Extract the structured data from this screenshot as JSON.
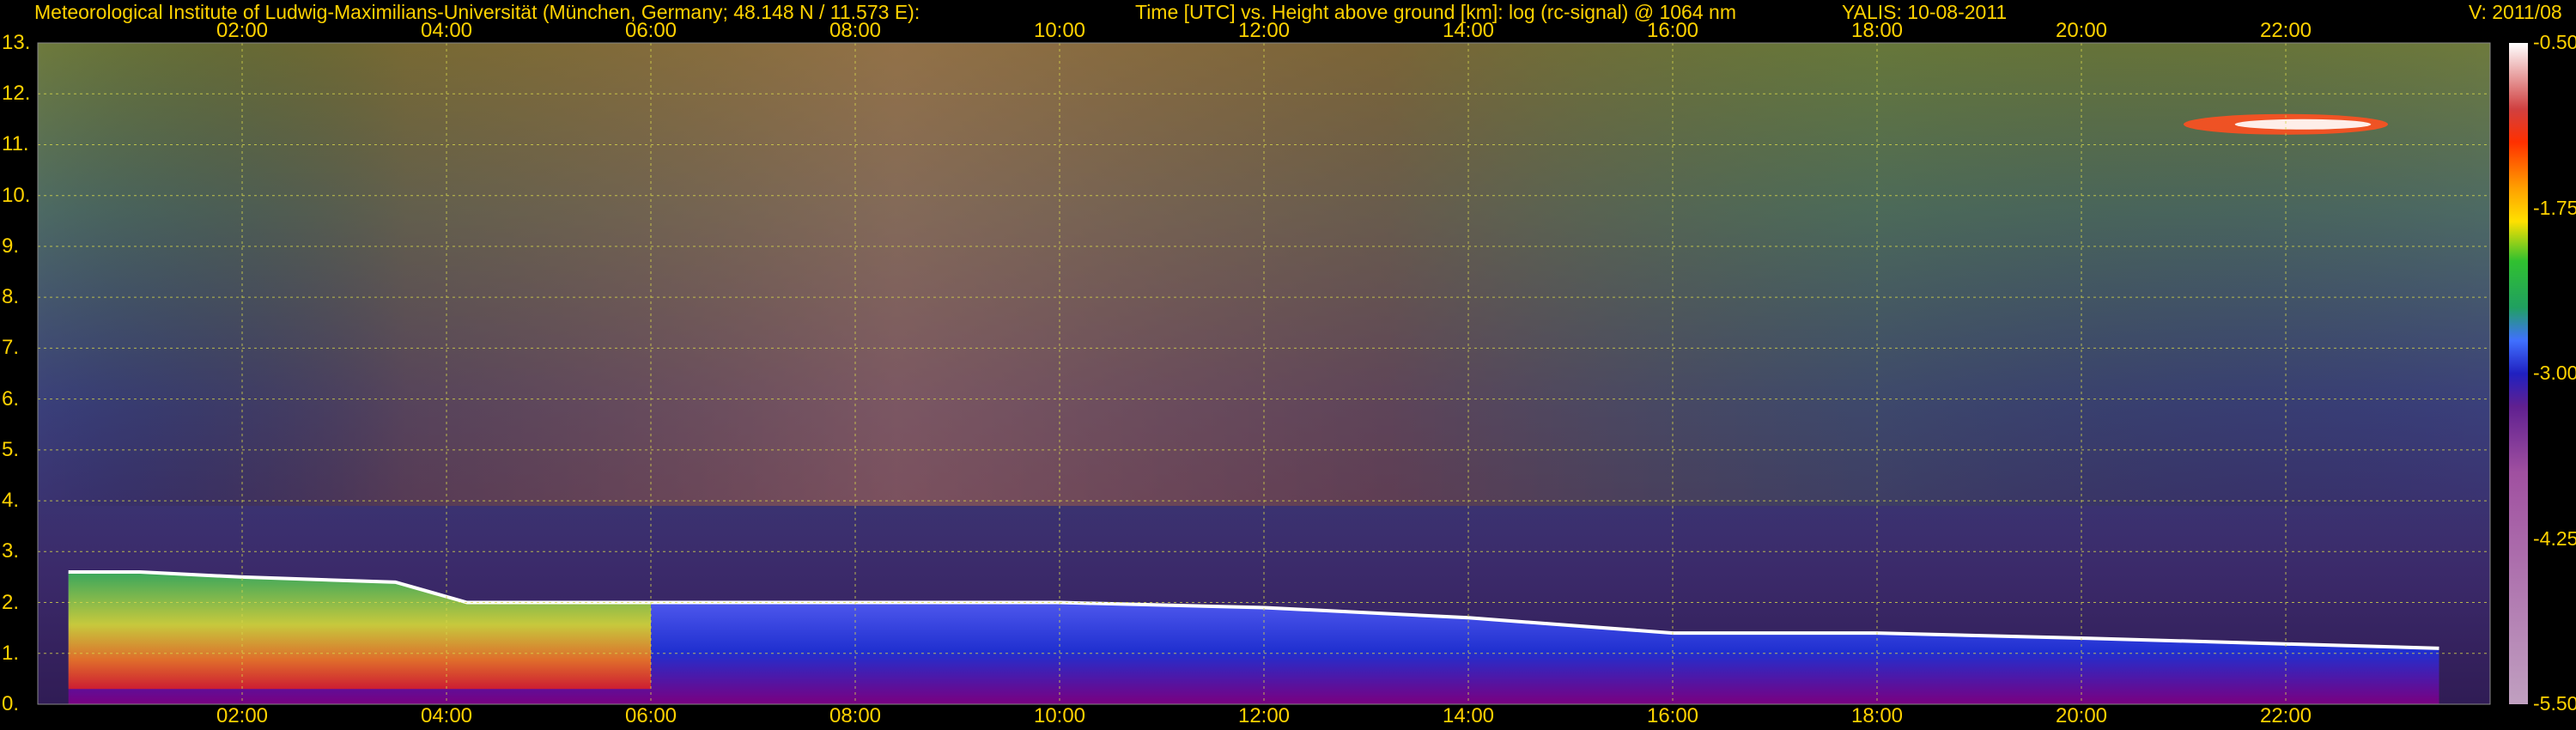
{
  "header": {
    "institute": "Meteorological Institute of Ludwig-Maximilians-Universität (München, Germany; 48.148 N / 11.573 E):",
    "axes_description": "Time [UTC] vs. Height above ground [km]: log (rc-signal) @ 1064 nm",
    "instrument_date": "YALIS: 10-08-2011",
    "version": "V: 2011/08"
  },
  "chart_data": {
    "type": "heatmap",
    "title": "Time [UTC] vs. Height above ground [km]: log (rc-signal) @ 1064 nm",
    "xlabel": "Time [UTC]",
    "ylabel": "Height above ground [km]",
    "x_ticks": [
      "02:00",
      "04:00",
      "06:00",
      "08:00",
      "10:00",
      "12:00",
      "14:00",
      "16:00",
      "18:00",
      "20:00",
      "22:00"
    ],
    "x_tick_hours": [
      2,
      4,
      6,
      8,
      10,
      12,
      14,
      16,
      18,
      20,
      22
    ],
    "xlim_hours": [
      0,
      24
    ],
    "y_ticks": [
      "0.",
      "1.",
      "2.",
      "3.",
      "4.",
      "5.",
      "6.",
      "7.",
      "8.",
      "9.",
      "10.",
      "11.",
      "12.",
      "13."
    ],
    "ylim_km": [
      0,
      13
    ],
    "colorbar": {
      "label": "log (rc-signal)",
      "range": [
        -5.5,
        -0.5
      ],
      "ticks": [
        "-0.50",
        "-1.75",
        "-3.00",
        "-4.25",
        "-5.50"
      ],
      "tick_values": [
        -0.5,
        -1.75,
        -3.0,
        -4.25,
        -5.5
      ]
    },
    "grid": true,
    "features": {
      "boundary_layer_top_km": [
        [
          0.3,
          2.6
        ],
        [
          1.0,
          2.6
        ],
        [
          2.0,
          2.5
        ],
        [
          3.5,
          2.4
        ],
        [
          4.2,
          2.0
        ],
        [
          6.0,
          2.0
        ],
        [
          8.0,
          2.0
        ],
        [
          10.0,
          2.0
        ],
        [
          12.0,
          1.9
        ],
        [
          14.0,
          1.7
        ],
        [
          16.0,
          1.4
        ],
        [
          18.0,
          1.4
        ],
        [
          20.0,
          1.3
        ],
        [
          23.5,
          1.1
        ]
      ],
      "high_cloud": {
        "start_hour": 21.0,
        "end_hour": 23.0,
        "height_km": 11.4
      }
    }
  },
  "colors": {
    "text": "#ffd200",
    "grid": "#d8d84a",
    "background": "#000000"
  }
}
